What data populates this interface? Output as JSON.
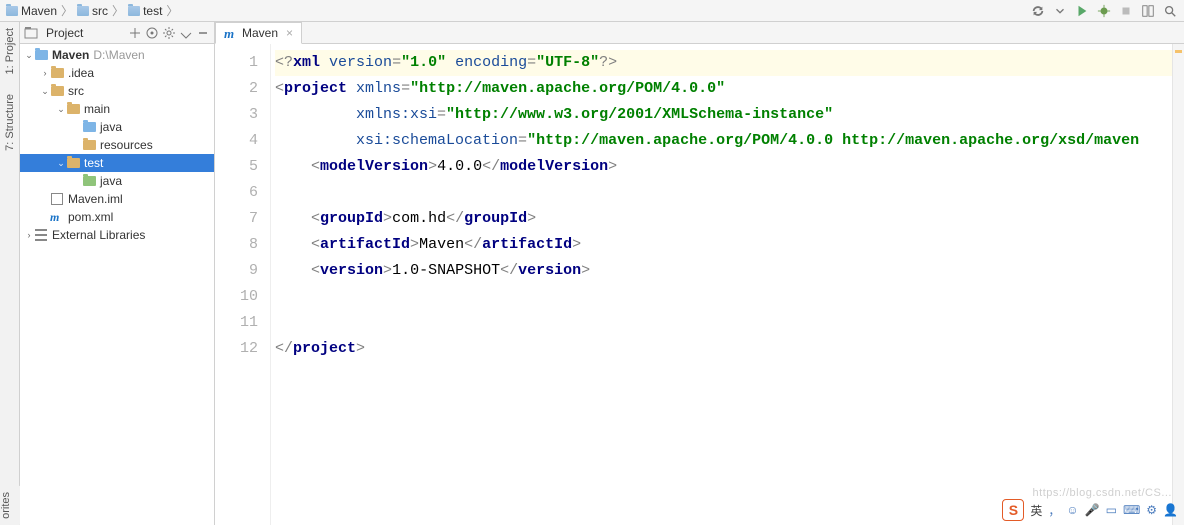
{
  "breadcrumb": [
    {
      "label": "Maven",
      "icon": "folder-blue"
    },
    {
      "label": "src",
      "icon": "folder-blue"
    },
    {
      "label": "test",
      "icon": "folder-blue"
    }
  ],
  "toolbar_right": [
    "sync-icon",
    "dropdown-icon",
    "run-icon",
    "debug-icon",
    "stop-icon",
    "layout-icon",
    "search-everywhere-icon"
  ],
  "side_tabs_left": [
    {
      "id": "project",
      "label": "1: Project"
    },
    {
      "id": "structure",
      "label": "7: Structure"
    }
  ],
  "side_tab_bottom_left": "orites",
  "project_panel": {
    "title": "Project",
    "header_icons": [
      "collapse-icon",
      "target-icon",
      "gear-icon",
      "hide-icon",
      "minimize-icon"
    ],
    "tree": [
      {
        "depth": 0,
        "toggle": "v",
        "icon": "folder-blue",
        "label": "Maven",
        "secondary": "D:\\Maven",
        "bold": true
      },
      {
        "depth": 1,
        "toggle": ">",
        "icon": "folder",
        "label": ".idea"
      },
      {
        "depth": 1,
        "toggle": "v",
        "icon": "folder",
        "label": "src"
      },
      {
        "depth": 2,
        "toggle": "v",
        "icon": "folder",
        "label": "main"
      },
      {
        "depth": 3,
        "toggle": "",
        "icon": "folder-blue",
        "label": "java"
      },
      {
        "depth": 3,
        "toggle": "",
        "icon": "folder",
        "label": "resources"
      },
      {
        "depth": 2,
        "toggle": "v",
        "icon": "folder",
        "label": "test",
        "selected": true
      },
      {
        "depth": 3,
        "toggle": "",
        "icon": "folder-green",
        "label": "java"
      },
      {
        "depth": 1,
        "toggle": "",
        "icon": "iml",
        "label": "Maven.iml"
      },
      {
        "depth": 1,
        "toggle": "",
        "icon": "m",
        "label": "pom.xml"
      },
      {
        "depth": 0,
        "toggle": ">",
        "icon": "lib",
        "label": "External Libraries"
      }
    ]
  },
  "editor": {
    "tabs": [
      {
        "icon": "m",
        "label": "Maven",
        "closeable": true,
        "active": true
      }
    ],
    "line_numbers": [
      "1",
      "2",
      "3",
      "4",
      "5",
      "6",
      "7",
      "8",
      "9",
      "10",
      "11",
      "12"
    ],
    "code_tokens": [
      [
        {
          "t": "delim",
          "v": "<?"
        },
        {
          "t": "tag",
          "v": "xml"
        },
        {
          "t": "txt",
          "v": " "
        },
        {
          "t": "attr",
          "v": "version"
        },
        {
          "t": "delim",
          "v": "="
        },
        {
          "t": "val",
          "v": "\"1.0\""
        },
        {
          "t": "txt",
          "v": " "
        },
        {
          "t": "attr",
          "v": "encoding"
        },
        {
          "t": "delim",
          "v": "="
        },
        {
          "t": "val",
          "v": "\"UTF-8\""
        },
        {
          "t": "delim",
          "v": "?>"
        }
      ],
      [
        {
          "t": "delim",
          "v": "<"
        },
        {
          "t": "tag",
          "v": "project"
        },
        {
          "t": "txt",
          "v": " "
        },
        {
          "t": "attr",
          "v": "xmlns"
        },
        {
          "t": "delim",
          "v": "="
        },
        {
          "t": "val",
          "v": "\"http://maven.apache.org/POM/4.0.0\""
        }
      ],
      [
        {
          "t": "txt",
          "v": "         "
        },
        {
          "t": "attr",
          "v": "xmlns:xsi"
        },
        {
          "t": "delim",
          "v": "="
        },
        {
          "t": "val",
          "v": "\"http://www.w3.org/2001/XMLSchema-instance\""
        }
      ],
      [
        {
          "t": "txt",
          "v": "         "
        },
        {
          "t": "attr",
          "v": "xsi:schemaLocation"
        },
        {
          "t": "delim",
          "v": "="
        },
        {
          "t": "val",
          "v": "\"http://maven.apache.org/POM/4.0.0 http://maven.apache.org/xsd/maven"
        }
      ],
      [
        {
          "t": "txt",
          "v": "    "
        },
        {
          "t": "delim",
          "v": "<"
        },
        {
          "t": "tag",
          "v": "modelVersion"
        },
        {
          "t": "delim",
          "v": ">"
        },
        {
          "t": "txt",
          "v": "4.0.0"
        },
        {
          "t": "delim",
          "v": "</"
        },
        {
          "t": "tag",
          "v": "modelVersion"
        },
        {
          "t": "delim",
          "v": ">"
        }
      ],
      [],
      [
        {
          "t": "txt",
          "v": "    "
        },
        {
          "t": "delim",
          "v": "<"
        },
        {
          "t": "tag",
          "v": "groupId"
        },
        {
          "t": "delim",
          "v": ">"
        },
        {
          "t": "txt",
          "v": "com.hd"
        },
        {
          "t": "delim",
          "v": "</"
        },
        {
          "t": "tag",
          "v": "groupId"
        },
        {
          "t": "delim",
          "v": ">"
        }
      ],
      [
        {
          "t": "txt",
          "v": "    "
        },
        {
          "t": "delim",
          "v": "<"
        },
        {
          "t": "tag",
          "v": "artifactId"
        },
        {
          "t": "delim",
          "v": ">"
        },
        {
          "t": "txt",
          "v": "Maven"
        },
        {
          "t": "delim",
          "v": "</"
        },
        {
          "t": "tag",
          "v": "artifactId"
        },
        {
          "t": "delim",
          "v": ">"
        }
      ],
      [
        {
          "t": "txt",
          "v": "    "
        },
        {
          "t": "delim",
          "v": "<"
        },
        {
          "t": "tag",
          "v": "version"
        },
        {
          "t": "delim",
          "v": ">"
        },
        {
          "t": "txt",
          "v": "1.0-SNAPSHOT"
        },
        {
          "t": "delim",
          "v": "</"
        },
        {
          "t": "tag",
          "v": "version"
        },
        {
          "t": "delim",
          "v": ">"
        }
      ],
      [],
      [],
      [
        {
          "t": "delim",
          "v": "</"
        },
        {
          "t": "tag",
          "v": "project"
        },
        {
          "t": "delim",
          "v": ">"
        }
      ]
    ]
  },
  "ime": {
    "sogou_label": "S",
    "lang": "英",
    "icons": [
      "emoji",
      "mic",
      "clipboard",
      "keyboard",
      "settings",
      "person"
    ]
  },
  "watermark": "https://blog.csdn.net/CS..."
}
